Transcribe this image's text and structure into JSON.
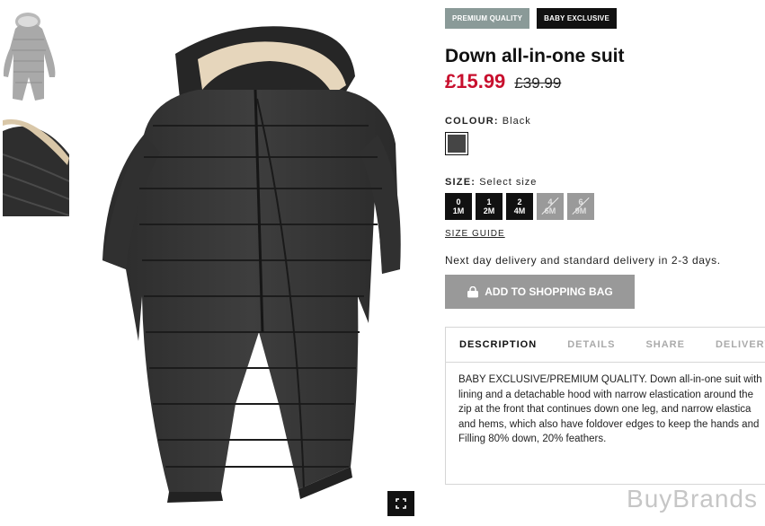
{
  "thumbnails": [
    {
      "alt": "suit-front-thumbnail"
    },
    {
      "alt": "hood-detail-thumbnail"
    }
  ],
  "badges": {
    "premium": "PREMIUM QUALITY",
    "exclusive": "BABY EXCLUSIVE"
  },
  "product": {
    "title": "Down all-in-one suit",
    "price": "£15.99",
    "old_price": "£39.99"
  },
  "colour": {
    "label": "COLOUR:",
    "value": "Black",
    "swatch_color": "#454545"
  },
  "size": {
    "label": "SIZE:",
    "hint": "Select size",
    "options": [
      {
        "top": "0",
        "bottom": "1M",
        "available": true
      },
      {
        "top": "1",
        "bottom": "2M",
        "available": true
      },
      {
        "top": "2",
        "bottom": "4M",
        "available": true
      },
      {
        "top": "4",
        "bottom": "6M",
        "available": false
      },
      {
        "top": "6",
        "bottom": "9M",
        "available": false
      }
    ],
    "guide": "SIZE GUIDE"
  },
  "delivery_text": "Next day delivery and standard delivery in 2-3 days.",
  "add_to_bag": "ADD TO SHOPPING BAG",
  "tabs": [
    "DESCRIPTION",
    "DETAILS",
    "SHARE",
    "DELIVERY"
  ],
  "description": "BABY EXCLUSIVE/PREMIUM QUALITY. Down all-in-one suit with\nlining and a detachable hood with narrow elastication around the\nzip at the front that continues down one leg, and narrow elastica\nand hems, which also have foldover edges to keep the hands and\nFilling 80% down, 20% feathers.",
  "watermark": "BuyBrands",
  "colors": {
    "price_red": "#c8102e",
    "badge_grey": "#8a9a98",
    "button_grey": "#999999"
  }
}
